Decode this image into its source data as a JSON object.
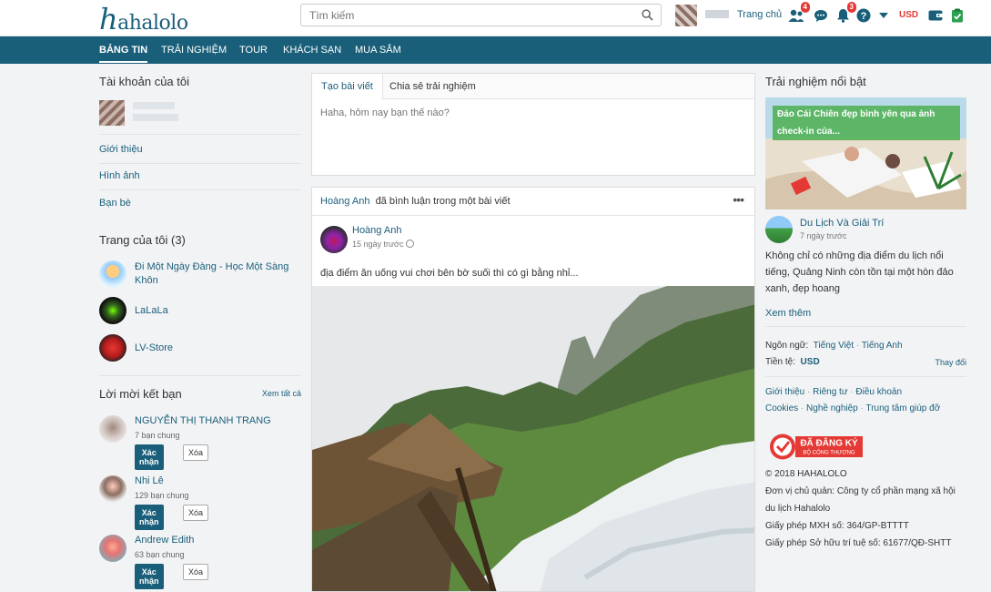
{
  "header": {
    "logo": "hahalolo",
    "search_placeholder": "Tìm kiếm",
    "home_label": "Trang chủ",
    "friend_badge": "4",
    "notif_badge": "3",
    "currency": "USD"
  },
  "nav": {
    "items": [
      "BẢNG TIN",
      "TRẢI NGHIỆM",
      "TOUR",
      "KHÁCH SẠN",
      "MUA SẮM"
    ]
  },
  "left": {
    "account_title": "Tài khoản của tôi",
    "links": [
      "Giới thiệu",
      "Hình ảnh",
      "Bạn bè"
    ],
    "pages_title": "Trang của tôi (3)",
    "pages": [
      {
        "name": "Đi Một Ngày Đàng - Học Một Sàng Khôn"
      },
      {
        "name": "LaLaLa"
      },
      {
        "name": "LV-Store"
      }
    ],
    "friends_title": "Lời mời kết bạn",
    "see_all": "Xem tất cả",
    "confirm_label": "Xác nhận",
    "delete_label": "Xóa",
    "requests": [
      {
        "name": "NGUYỄN THỊ THANH TRANG",
        "mutual": "7 bạn chung"
      },
      {
        "name": "Nhi Lê",
        "mutual": "129 bạn chung"
      },
      {
        "name": "Andrew Edith",
        "mutual": "63 bạn chung"
      }
    ]
  },
  "composer": {
    "tab_create": "Tạo bài viết",
    "tab_share": "Chia sẻ trải nghiệm",
    "placeholder": "Haha, hôm nay bạn thế nào?"
  },
  "post": {
    "activity_user": "Hoàng Anh",
    "activity_text": "đã bình luận trong một bài viết",
    "author": "Hoàng Anh",
    "time": "15 ngày trước",
    "text": "địa điểm ăn uống vui chơi bên bờ suối thì có gì bằng nhỉ..."
  },
  "right": {
    "title": "Trải nghiệm nổi bật",
    "featured_caption": "Đảo Cái Chiên đẹp bình yên qua ảnh check-in của...",
    "featured_author": "Du Lịch Và Giải Trí",
    "featured_time": "7 ngày trước",
    "featured_desc": "Không chỉ có những địa điểm du lịch nổi tiếng, Quảng Ninh còn tồn tại một hòn đảo xanh, đẹp hoang",
    "see_more": "Xem thêm",
    "language_label": "Ngôn ngữ:",
    "lang_vi": "Tiếng Việt",
    "lang_en": "Tiếng Anh",
    "currency_label": "Tiền tệ:",
    "currency_value": "USD",
    "change": "Thay đổi",
    "footer_row1": [
      "Giới thiệu",
      "Riêng tư",
      "Điều khoản"
    ],
    "footer_row2": [
      "Cookies",
      "Nghề nghiệp",
      "Trung tâm giúp đỡ"
    ],
    "reg_line1": "ĐÃ ĐĂNG KÝ",
    "reg_line2": "BỘ CÔNG THƯƠNG",
    "copyright": "© 2018 HAHALOLO",
    "owner": "Đơn vị chủ quản: Công ty cổ phần mạng xã hội du lịch Hahalolo",
    "license1": "Giấy phép MXH số: 364/GP-BTTTT",
    "license2": "Giấy phép Sở hữu trí tuệ số: 61677/QĐ-SHTT"
  }
}
